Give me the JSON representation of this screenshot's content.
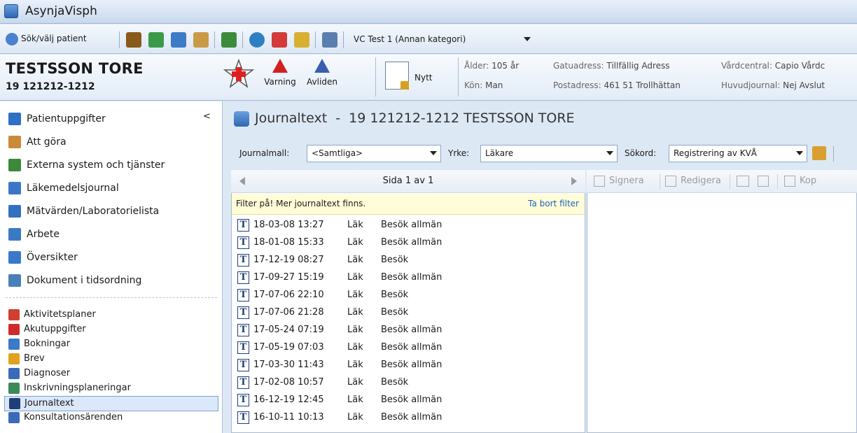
{
  "window": {
    "title": "AsynjaVisph"
  },
  "toolbar": {
    "search_patient_label": "Sök/välj patient",
    "unit_combo": "VC Test 1 (Annan kategori)"
  },
  "patient": {
    "name": "TESTSSON TORE",
    "id": "19 121212-1212",
    "buttons": {
      "warning": "Varning",
      "deceased": "Avliden",
      "new": "Nytt"
    },
    "info": {
      "age_label": "Ålder:",
      "age_value": "105 år",
      "gender_label": "Kön:",
      "gender_value": "Man",
      "street_label": "Gatuadress:",
      "street_value": "Tillfällig Adress",
      "postal_label": "Postadress:",
      "postal_value": "461 51 Trollhättan",
      "center_label": "Vårdcentral:",
      "center_value": "Capio Vårdc",
      "main_journal_label": "Huvudjournal:",
      "main_journal_value": "Nej Avslut"
    }
  },
  "sidebar": {
    "collapse_glyph": "<",
    "items": [
      {
        "label": "Patientuppgifter",
        "icon": "person-icon",
        "color": "#2f6fc4"
      },
      {
        "label": "Att göra",
        "icon": "clipboard-icon",
        "color": "#c98a3a"
      },
      {
        "label": "Externa system och tjänster",
        "icon": "network-icon",
        "color": "#3a8a3a"
      },
      {
        "label": "Läkemedelsjournal",
        "icon": "medicine-icon",
        "color": "#3b77c8"
      },
      {
        "label": "Mätvärden/Laboratorielista",
        "icon": "chart-icon",
        "color": "#3470c0"
      },
      {
        "label": "Arbete",
        "icon": "work-icon",
        "color": "#3a7ac2"
      },
      {
        "label": "Översikter",
        "icon": "grid-icon",
        "color": "#3a78c8"
      },
      {
        "label": "Dokument i tidsordning",
        "icon": "document-icon",
        "color": "#4b7fb8"
      }
    ],
    "subitems": [
      {
        "label": "Aktivitetsplaner",
        "icon": "checklist-icon",
        "color": "#d04030"
      },
      {
        "label": "Akutuppgifter",
        "icon": "emergency-icon",
        "color": "#d02a2a"
      },
      {
        "label": "Bokningar",
        "icon": "calendar-icon",
        "color": "#3a7ac8"
      },
      {
        "label": "Brev",
        "icon": "letter-icon",
        "color": "#e0a020"
      },
      {
        "label": "Diagnoser",
        "icon": "diagnosis-icon",
        "color": "#3a6ab8"
      },
      {
        "label": "Inskrivningsplaneringar",
        "icon": "admission-icon",
        "color": "#3a8a5a"
      },
      {
        "label": "Journaltext",
        "icon": "journal-icon",
        "color": "#1e3f77"
      },
      {
        "label": "Konsultationsärenden",
        "icon": "consultation-icon",
        "color": "#3a6ab8"
      }
    ],
    "selected_index": 6
  },
  "journal": {
    "header": {
      "title": "Journaltext",
      "sep": "-",
      "patient": "19 121212-1212 TESTSSON TORE"
    },
    "filters": {
      "template_label": "Journalmall:",
      "template_value": "<Samtliga>",
      "profession_label": "Yrke:",
      "profession_value": "Läkare",
      "keyword_label": "Sökord:",
      "keyword_value": "Registrering av KVÅ"
    },
    "pager": {
      "text": "Sida 1 av 1"
    },
    "filter_notice": {
      "text": "Filter på! Mer journaltext finns.",
      "link": "Ta bort filter"
    },
    "entries": [
      {
        "datetime": "18-03-08 13:27",
        "prof": "Läk",
        "type": "Besök allmän"
      },
      {
        "datetime": "18-01-08 15:33",
        "prof": "Läk",
        "type": "Besök allmän"
      },
      {
        "datetime": "17-12-19 08:27",
        "prof": "Läk",
        "type": "Besök"
      },
      {
        "datetime": "17-09-27 15:19",
        "prof": "Läk",
        "type": "Besök allmän"
      },
      {
        "datetime": "17-07-06 22:10",
        "prof": "Läk",
        "type": "Besök"
      },
      {
        "datetime": "17-07-06 21:28",
        "prof": "Läk",
        "type": "Besök"
      },
      {
        "datetime": "17-05-24 07:19",
        "prof": "Läk",
        "type": "Besök allmän"
      },
      {
        "datetime": "17-05-19 07:03",
        "prof": "Läk",
        "type": "Besök allmän"
      },
      {
        "datetime": "17-03-30 11:43",
        "prof": "Läk",
        "type": "Besök allmän"
      },
      {
        "datetime": "17-02-08 10:57",
        "prof": "Läk",
        "type": "Besök"
      },
      {
        "datetime": "16-12-19 12:45",
        "prof": "Läk",
        "type": "Besök allmän"
      },
      {
        "datetime": "16-10-11 10:13",
        "prof": "Läk",
        "type": "Besök allmän"
      }
    ],
    "actions": {
      "sign": "Signera",
      "edit": "Redigera",
      "copy": "Kop"
    }
  },
  "colors": {
    "accent": "#2f66b3",
    "filter_bg": "#fffdd7",
    "link": "#1f5fbf",
    "selected_bg": "#dbe8fa"
  }
}
